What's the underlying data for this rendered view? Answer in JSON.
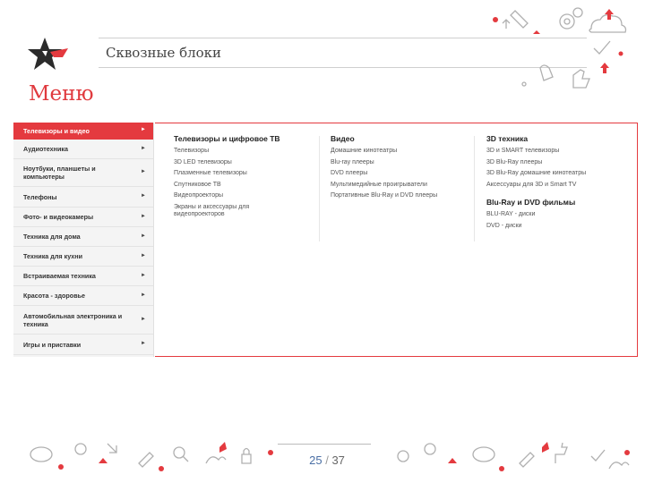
{
  "header": {
    "section": "Сквозные блоки",
    "title": "Меню"
  },
  "sidebar": {
    "items": [
      {
        "label": "Телевизоры и видео",
        "active": true
      },
      {
        "label": "Аудиотехника"
      },
      {
        "label": "Ноутбуки, планшеты и компьютеры"
      },
      {
        "label": "Телефоны"
      },
      {
        "label": "Фото- и видеокамеры"
      },
      {
        "label": "Техника для дома"
      },
      {
        "label": "Техника для кухни"
      },
      {
        "label": "Встраиваемая техника"
      },
      {
        "label": "Красота - здоровье"
      },
      {
        "label": "Автомобильная электроника и техника"
      },
      {
        "label": "Игры и приставки"
      }
    ],
    "arrow": "►"
  },
  "submenu": {
    "columns": [
      {
        "groups": [
          {
            "title": "Телевизоры и цифровое ТВ",
            "links": [
              "Телевизоры",
              "3D LED телевизоры",
              "Плазменные телевизоры",
              "Спутниковое ТВ",
              "Видеопроекторы",
              "Экраны и аксессуары для видеопроекторов"
            ]
          }
        ]
      },
      {
        "groups": [
          {
            "title": "Видео",
            "links": [
              "Домашние кинотеатры",
              "Blu-ray плееры",
              "DVD плееры",
              "Мультимедийные проигрыватели",
              "Портативные Blu-Ray и DVD плееры"
            ]
          }
        ]
      },
      {
        "groups": [
          {
            "title": "3D техника",
            "links": [
              "3D и SMART телевизоры",
              "3D Blu-Ray плееры",
              "3D Blu-Ray домашние кинотеатры",
              "Аксессуары для 3D и Smart TV"
            ]
          },
          {
            "title": "Blu-Ray и DVD фильмы",
            "links": [
              "BLU-RAY - диски",
              "DVD - диски"
            ]
          }
        ]
      }
    ]
  },
  "pager": {
    "current": "25",
    "separator": "/",
    "total": "37"
  },
  "colors": {
    "accent": "#e43a3f",
    "sidebar_bg": "#f4f4f4",
    "pager": "#4a6fa5"
  }
}
